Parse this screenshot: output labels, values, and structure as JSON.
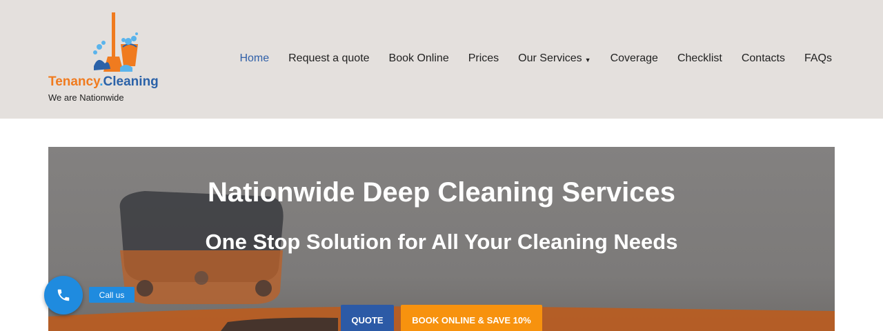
{
  "brand": {
    "name_part1": "Tenancy",
    "name_dot": ".",
    "name_part2": "Cleaning",
    "tagline": "We are Nationwide",
    "logo_icon": "mop-bucket-icon"
  },
  "nav": {
    "items": [
      {
        "label": "Home",
        "active": true
      },
      {
        "label": "Request a quote"
      },
      {
        "label": "Book Online"
      },
      {
        "label": "Prices"
      },
      {
        "label": "Our Services",
        "dropdown": true
      },
      {
        "label": "Coverage"
      },
      {
        "label": "Checklist"
      },
      {
        "label": "Contacts"
      },
      {
        "label": "FAQs"
      }
    ]
  },
  "hero": {
    "title": "Nationwide Deep Cleaning Services",
    "subtitle": "One Stop Solution for All Your Cleaning Needs",
    "quote_button": "QUOTE",
    "book_button": "BOOK ONLINE & SAVE 10%"
  },
  "call_widget": {
    "label": "Call us",
    "icon": "phone-icon"
  },
  "colors": {
    "header_bg": "#e4e0dd",
    "nav_active": "#2f5fa8",
    "quote_button": "#2c5aa6",
    "book_button": "#f7920e",
    "call_widget": "#1f8bdf",
    "brand_orange": "#f07b1f",
    "brand_blue": "#2b62a8"
  }
}
